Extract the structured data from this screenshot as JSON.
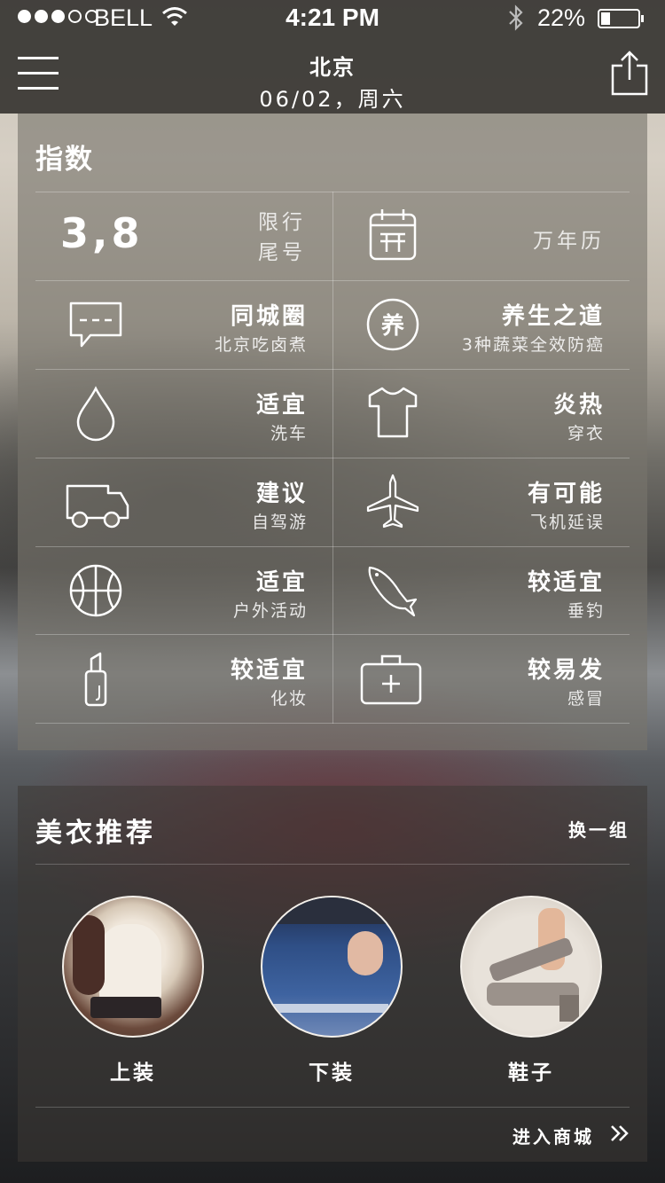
{
  "status_bar": {
    "signal_filled": 3,
    "signal_total": 5,
    "carrier": "BELL",
    "time": "4:21 PM",
    "battery_percent": "22%",
    "battery_level": 0.22
  },
  "header": {
    "city": "北京",
    "date": "06/02，周六",
    "menu_icon": "hamburger-icon",
    "share_icon": "share-icon"
  },
  "index_section": {
    "title": "指数",
    "license_plate": {
      "value": "3,8",
      "label_line1": "限行",
      "label_line2": "尾号"
    },
    "calendar": {
      "icon": "calendar-icon",
      "label": "万年历"
    },
    "items": [
      {
        "icon": "chat-bubble-icon",
        "main": "同城圈",
        "sub": "北京吃卤煮"
      },
      {
        "icon": "yangsheng-badge-icon",
        "badge_text": "养",
        "main": "养生之道",
        "sub": "3种蔬菜全效防癌"
      },
      {
        "icon": "water-drop-icon",
        "main": "适宜",
        "sub": "洗车"
      },
      {
        "icon": "tshirt-icon",
        "main": "炎热",
        "sub": "穿衣"
      },
      {
        "icon": "truck-icon",
        "main": "建议",
        "sub": "自驾游"
      },
      {
        "icon": "airplane-icon",
        "main": "有可能",
        "sub": "飞机延误"
      },
      {
        "icon": "basketball-icon",
        "main": "适宜",
        "sub": "户外活动"
      },
      {
        "icon": "fish-icon",
        "main": "较适宜",
        "sub": "垂钓"
      },
      {
        "icon": "lipstick-icon",
        "main": "较适宜",
        "sub": "化妆"
      },
      {
        "icon": "medical-kit-icon",
        "main": "较易发",
        "sub": "感冒"
      }
    ]
  },
  "fashion_section": {
    "title": "美衣推荐",
    "switch_label": "换一组",
    "products": [
      {
        "label": "上装"
      },
      {
        "label": "下装"
      },
      {
        "label": "鞋子"
      }
    ],
    "store_link": "进入商城",
    "store_icon": "double-chevron-right-icon"
  },
  "colors": {
    "topbar": "#37352f",
    "text": "#ffffff"
  }
}
